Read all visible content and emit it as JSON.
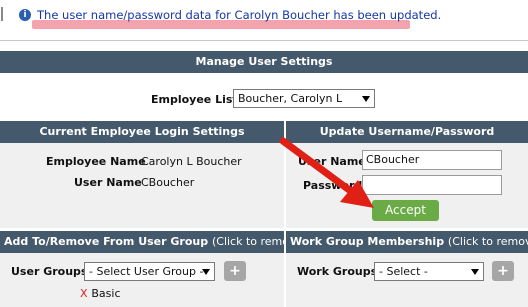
{
  "notice": {
    "icon": "info-icon",
    "text": "The user name/password data for Carolyn Boucher has been updated."
  },
  "manage": {
    "title": "Manage User Settings",
    "employee_list_label": "Employee List",
    "employee_list_value": "Boucher, Carolyn L"
  },
  "current": {
    "title": "Current Employee Login Settings",
    "employee_name_label": "Employee Name",
    "employee_name_value": "Carolyn L Boucher",
    "user_name_label": "User Name",
    "user_name_value": "CBoucher"
  },
  "update": {
    "title": "Update Username/Password",
    "user_name_label": "User Name",
    "user_name_value": "CBoucher",
    "password_label": "Password",
    "password_value": "",
    "accept_label": "Accept"
  },
  "groups": {
    "title": "Add To/Remove From User Group",
    "title_hint": "(Click to remove)",
    "label": "User Groups",
    "select_value": "- Select User Group -",
    "add_label": "+",
    "items": [
      {
        "remove": "X",
        "name": "Basic"
      }
    ]
  },
  "workgroups": {
    "title": "Work Group Membership",
    "title_hint": "(Click to remove)",
    "label": "Work Groups",
    "select_value": "- Select -",
    "add_label": "+"
  },
  "colors": {
    "bar": "#44596b",
    "panel": "#f0f0f0",
    "accept": "#6aab45",
    "arrow": "#e02015",
    "notice_text": "#1536a8"
  }
}
